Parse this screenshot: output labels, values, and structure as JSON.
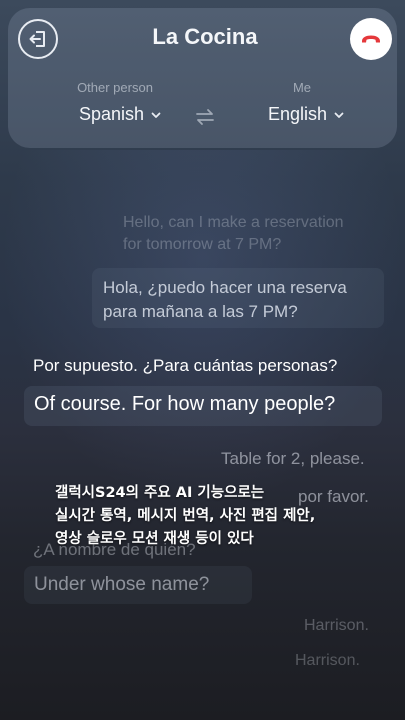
{
  "header": {
    "title": "La Cocina",
    "other_person_label": "Other person",
    "me_label": "Me",
    "other_language": "Spanish",
    "my_language": "English"
  },
  "icons": {
    "exit": "exit-icon",
    "end_call": "end-call-icon",
    "swap": "swap-icon",
    "chevron": "chevron-down-icon"
  },
  "conversation": {
    "m1_line1": "Hello, can I make a reservation",
    "m1_line2": "for tomorrow at 7 PM?",
    "m2_line1": "Hola, ¿puedo hacer una reserva",
    "m2_line2": "para mañana a las 7 PM?",
    "m3": "Por supuesto. ¿Para cuántas personas?",
    "m4": "Of course. For how many people?",
    "m5": "Table for 2, please.",
    "m6": "por favor.",
    "m7": "¿A nombre de quién?",
    "m8": "Under whose name?",
    "m9": "Harrison.",
    "m10": "Harrison."
  },
  "caption": {
    "line1": "갤럭시S24의 주요 AI 기능으로는",
    "line2": "실시간 통역, 메시지 번역, 사진 편집 제안,",
    "line3": "영상 슬로우 모션 재생 등이 있다"
  },
  "colors": {
    "end_call_red": "#e5383b",
    "text_light": "#f4f6f9"
  }
}
